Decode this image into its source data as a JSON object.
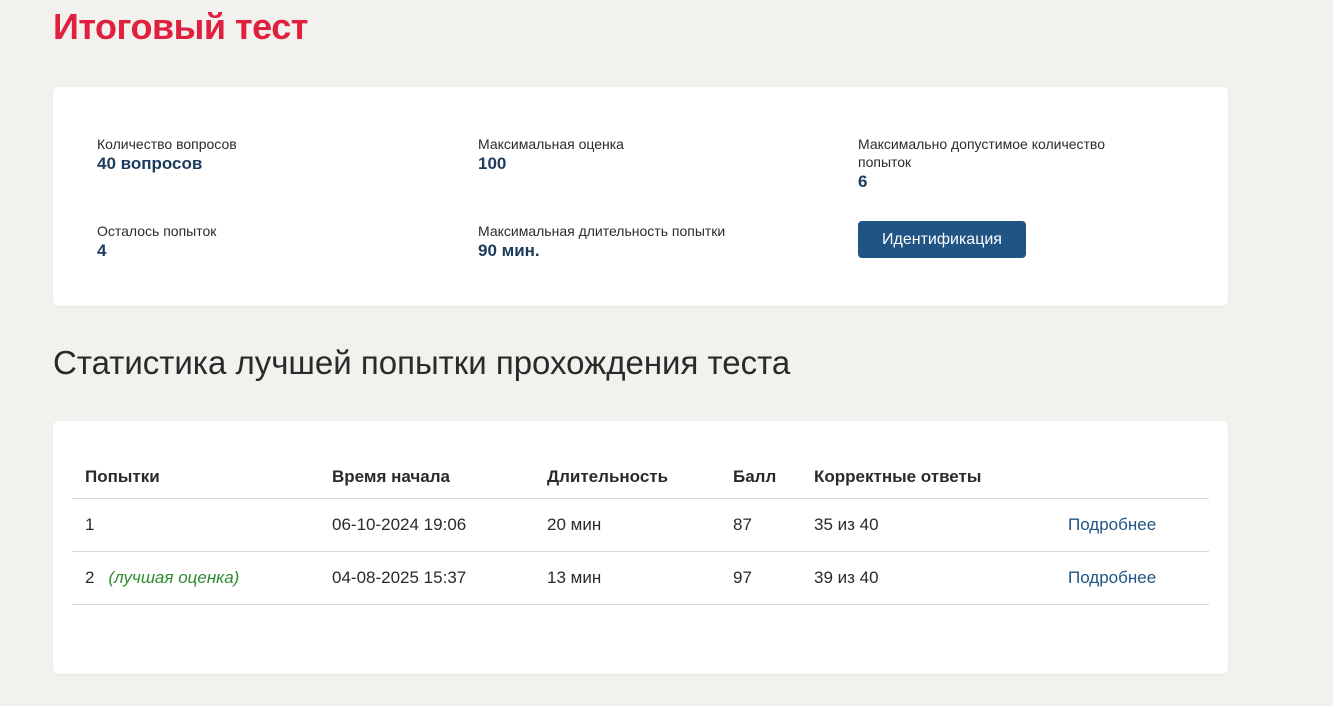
{
  "page": {
    "title": "Итоговый тест"
  },
  "info": {
    "questions_label": "Количество вопросов",
    "questions_value": "40 вопросов",
    "max_score_label": "Максимальная оценка",
    "max_score_value": "100",
    "max_attempts_label": "Максимально допустимое количество попыток",
    "max_attempts_value": "6",
    "remaining_label": "Осталось попыток",
    "remaining_value": "4",
    "max_duration_label": "Максимальная длительность попытки",
    "max_duration_value": "90 мин.",
    "identify_button": "Идентификация"
  },
  "stats": {
    "title": "Статистика лучшей попытки прохождения теста",
    "columns": [
      "Попытки",
      "Время начала",
      "Длительность",
      "Балл",
      "Корректные ответы",
      ""
    ],
    "rows": [
      {
        "attempt": "1",
        "note": "",
        "start": "06-10-2024 19:06",
        "duration": "20 мин",
        "score": "87",
        "correct": "35 из 40",
        "link": "Подробнее"
      },
      {
        "attempt": "2",
        "note": "(лучшая оценка)",
        "start": "04-08-2025 15:37",
        "duration": "13 мин",
        "score": "97",
        "correct": "39 из 40",
        "link": "Подробнее"
      }
    ]
  },
  "colors": {
    "title_red": "#e0203f",
    "value_blue": "#1d3b5c",
    "button_blue": "#1f5485",
    "best_green": "#2e8b2e",
    "background": "#f3f1ee"
  }
}
